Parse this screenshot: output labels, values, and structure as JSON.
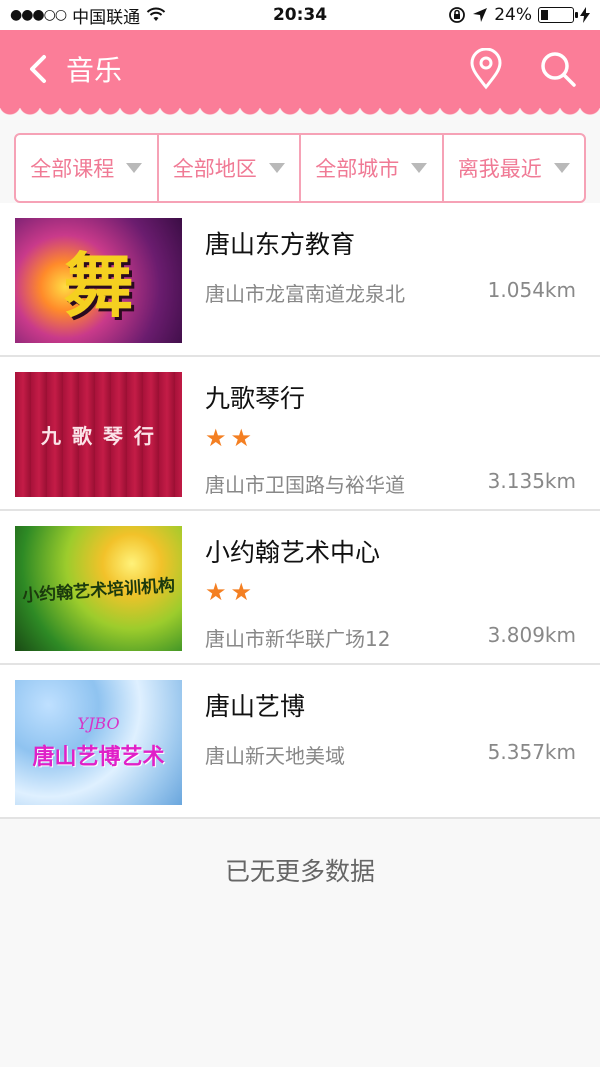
{
  "status_bar": {
    "signal": "●●●○○",
    "carrier": "中国联通",
    "time": "20:34",
    "battery_percent": "24%",
    "battery_level": 0.24
  },
  "header": {
    "title": "音乐",
    "background": "#fb7d98"
  },
  "filters": [
    {
      "label": "全部课程"
    },
    {
      "label": "全部地区"
    },
    {
      "label": "全部城市"
    },
    {
      "label": "离我最近"
    }
  ],
  "items": [
    {
      "name": "唐山东方教育",
      "stars": "",
      "address": "唐山市龙富南道龙泉北",
      "distance": "1.054km",
      "thumb_text": "舞"
    },
    {
      "name": "九歌琴行",
      "stars": "★★",
      "address": "唐山市卫国路与裕华道",
      "distance": "3.135km",
      "thumb_text": "九 歌 琴 行"
    },
    {
      "name": "小约翰艺术中心",
      "stars": "★★",
      "address": "唐山市新华联广场12",
      "distance": "3.809km",
      "thumb_text": "小约翰艺术培训机构"
    },
    {
      "name": "唐山艺博",
      "stars": "",
      "address": "唐山新天地美域",
      "distance": "5.357km",
      "thumb_text": "唐山艺博艺术",
      "thumb_subtext": "YJBO"
    }
  ],
  "footer": {
    "no_more": "已无更多数据"
  }
}
